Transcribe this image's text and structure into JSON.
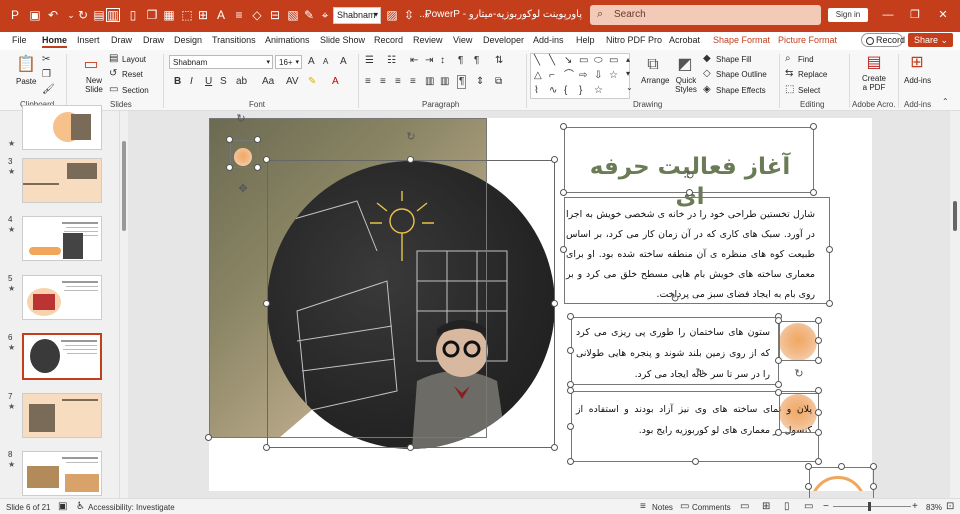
{
  "app": {
    "font_box": "Shabnam",
    "document_title": "پاورپوینت لوکوربوزیه-میتارو - PowerP...",
    "search_placeholder": "Search",
    "sign_in": "Sign in",
    "accent_color": "#C43E1C"
  },
  "quick_access_icons": [
    "app-icon",
    "save-icon",
    "autosave-icon",
    "undo-icon",
    "redo-icon",
    "present-icon",
    "layout-icon",
    "file-icon",
    "copy-icon",
    "paste-icon",
    "format-icon",
    "table-icon",
    "text-icon",
    "shape-icon",
    "highlight-icon",
    "brush-icon",
    "more-icon"
  ],
  "menu": {
    "tabs": [
      "File",
      "Home",
      "Insert",
      "Draw",
      "Draw",
      "Design",
      "Transitions",
      "Animations",
      "Slide Show",
      "Record",
      "Review",
      "View",
      "Developer",
      "Add-ins",
      "Help",
      "Nitro PDF Pro",
      "Acrobat"
    ],
    "contextual_tabs": [
      "Shape Format",
      "Picture Format"
    ],
    "active_tab": "Home",
    "record": "Record",
    "share": "Share"
  },
  "ribbon": {
    "clipboard": {
      "paste": "Paste",
      "group": "Clipboard"
    },
    "slides": {
      "new_slide": "New Slide",
      "layout": "Layout",
      "reset": "Reset",
      "section": "Section",
      "group": "Slides"
    },
    "font": {
      "name": "Shabnam",
      "size": "16+",
      "group": "Font"
    },
    "paragraph": {
      "group": "Paragraph"
    },
    "drawing": {
      "arrange": "Arrange",
      "quick_styles": "Quick Styles",
      "shape_fill": "Shape Fill",
      "shape_outline": "Shape Outline",
      "shape_effects": "Shape Effects",
      "group": "Drawing"
    },
    "editing": {
      "find": "Find",
      "replace": "Replace",
      "select": "Select",
      "group": "Editing"
    },
    "adobe": {
      "create_pdf": "Create a PDF",
      "group": "Adobe Acro..."
    },
    "addins": {
      "label": "Add-ins",
      "group": "Add-ins"
    }
  },
  "thumbnails": [
    {
      "num": "",
      "star": true
    },
    {
      "num": "3",
      "star": true
    },
    {
      "num": "4",
      "star": true
    },
    {
      "num": "5",
      "star": true
    },
    {
      "num": "6",
      "star": true,
      "selected": true
    },
    {
      "num": "7",
      "star": true
    },
    {
      "num": "8",
      "star": true
    }
  ],
  "slide": {
    "title": "آغاز فعالیت حرفه ای",
    "paragraph1": "شارل تخستین طراحی خود را در خانه ی شخصی خویش به اجرا در آورد. سبک های کاری که در آن زمان کار می کرد، بر اساس طبیعت کوه های منظره ی آن منطقه ساخته شده بود. او برای معماری ساخته های خویش بام هایی مسطح خلق می کرد و بر روی بام به ایجاد فضای سبز می پرداخت.",
    "paragraph2": "ستون های ساختمان را طوری پی ریزی می کرد که از روی زمین بلند شوند و پنجره هایی طولانی را در سر تا سر خانه ایجاد می کرد.",
    "paragraph3": "پلان و نمای ساخته های وی نیز آزاد بودند و استفاده از کنسول در معماری های لو کوربوزیه رایج بود."
  },
  "status": {
    "slide_info": "Slide 6 of 21",
    "accessibility": "Accessibility: Investigate",
    "notes": "Notes",
    "comments": "Comments",
    "zoom": "83%"
  }
}
